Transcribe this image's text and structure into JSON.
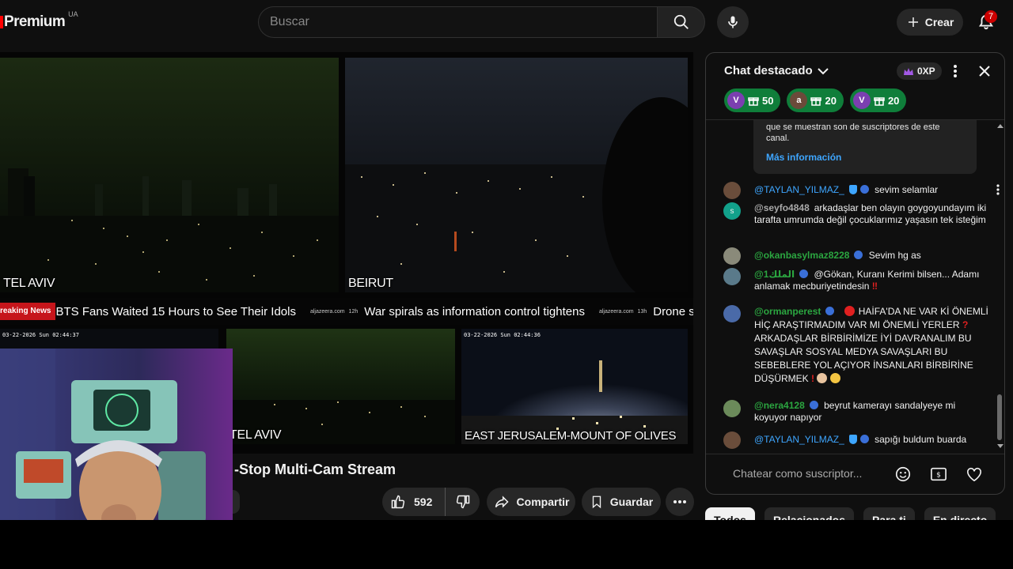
{
  "header": {
    "logo_text": "Premium",
    "logo_region": "UA",
    "search_placeholder": "Buscar",
    "create_label": "Crear",
    "notification_count": "7"
  },
  "video": {
    "cams": [
      {
        "label": "TEL AVIV",
        "timestamp": ""
      },
      {
        "label": "BEIRUT",
        "timestamp": ""
      },
      {
        "label": "",
        "timestamp": "03-22-2026 Sun 02:44:37"
      },
      {
        "label": "TEL AVIV",
        "timestamp": ""
      },
      {
        "label": "EAST JERUSALEM-MOUNT OF OLIVES",
        "timestamp": "03-22-2026 Sun 02:44:36"
      }
    ],
    "ticker": {
      "breaking": "reaking News",
      "items": [
        {
          "text": "BTS Fans Waited 15 Hours to See Their Idols",
          "source": "aljazeera.com",
          "age": "12h"
        },
        {
          "text": "War spirals as information control tightens",
          "source": "aljazeera.com",
          "age": "13h"
        },
        {
          "text": "Drone strik",
          "source": "",
          "age": ""
        }
      ]
    },
    "title": "-Stop Multi-Cam Stream",
    "like_count": "592",
    "share_label": "Compartir",
    "save_label": "Guardar"
  },
  "chat": {
    "title": "Chat destacado",
    "xp_label": "0XP",
    "tickers": [
      {
        "initial": "V",
        "amount": "50",
        "color": "#7b3fb0"
      },
      {
        "initial": "a",
        "amount": "20",
        "color": "#6b4a3a"
      },
      {
        "initial": "V",
        "amount": "20",
        "color": "#7b3fb0"
      }
    ],
    "info_text": "que se muestran son de suscriptores de este canal.",
    "info_link": "Más información",
    "messages": [
      {
        "author": "@TAYLAN_YILMAZ_",
        "text": "sevim selamlar",
        "avatar_color": "#6a4d3b"
      },
      {
        "author": "@seyfo4848",
        "text": "arkadaşlar ben olayın goygoyundayım iki tarafta umrumda değil çocuklarımız yaşasın tek isteğim",
        "avatar_color": "#12a18b",
        "initial": "s"
      },
      {
        "author": "@okanbasylmaz8228",
        "text": "Sevim hg as",
        "avatar_color": "#8a8a7a"
      },
      {
        "author": "@الملك1",
        "text": "@Gökan, Kuranı Kerimi bilsen... Adamı anlamak mecburiyetindesin",
        "emoji_end": "‼",
        "avatar_color": "#5a7a8a"
      },
      {
        "author": "@ormanperest",
        "text": "HAİFA'DA NE VAR Kİ ÖNEMLİ HİÇ ARAŞTIRMADIM VAR MI ÖNEMLİ YERLER",
        "text2": "ARKADAŞLAR BİRBİRİMİZE İYİ DAVRANALIM BU SAVAŞLAR SOSYAL MEDYA SAVAŞLARI BU SEBEBLERE YOL AÇIYOR İNSANLARI BİRBİRİNE DÜŞÜRMEK",
        "avatar_color": "#4a6aa8"
      },
      {
        "author": "@nera4128",
        "text": "beyrut kamerayı sandalyeye mi koyuyor napıyor",
        "avatar_color": "#6b8a5a"
      },
      {
        "author": "@TAYLAN_YILMAZ_",
        "text": "sapığı buldum buarda",
        "avatar_color": "#6a4d3b"
      }
    ],
    "input_placeholder": "Chatear como suscriptor..."
  },
  "chips": [
    "Todos",
    "Relacionados",
    "Para ti",
    "En directo"
  ]
}
